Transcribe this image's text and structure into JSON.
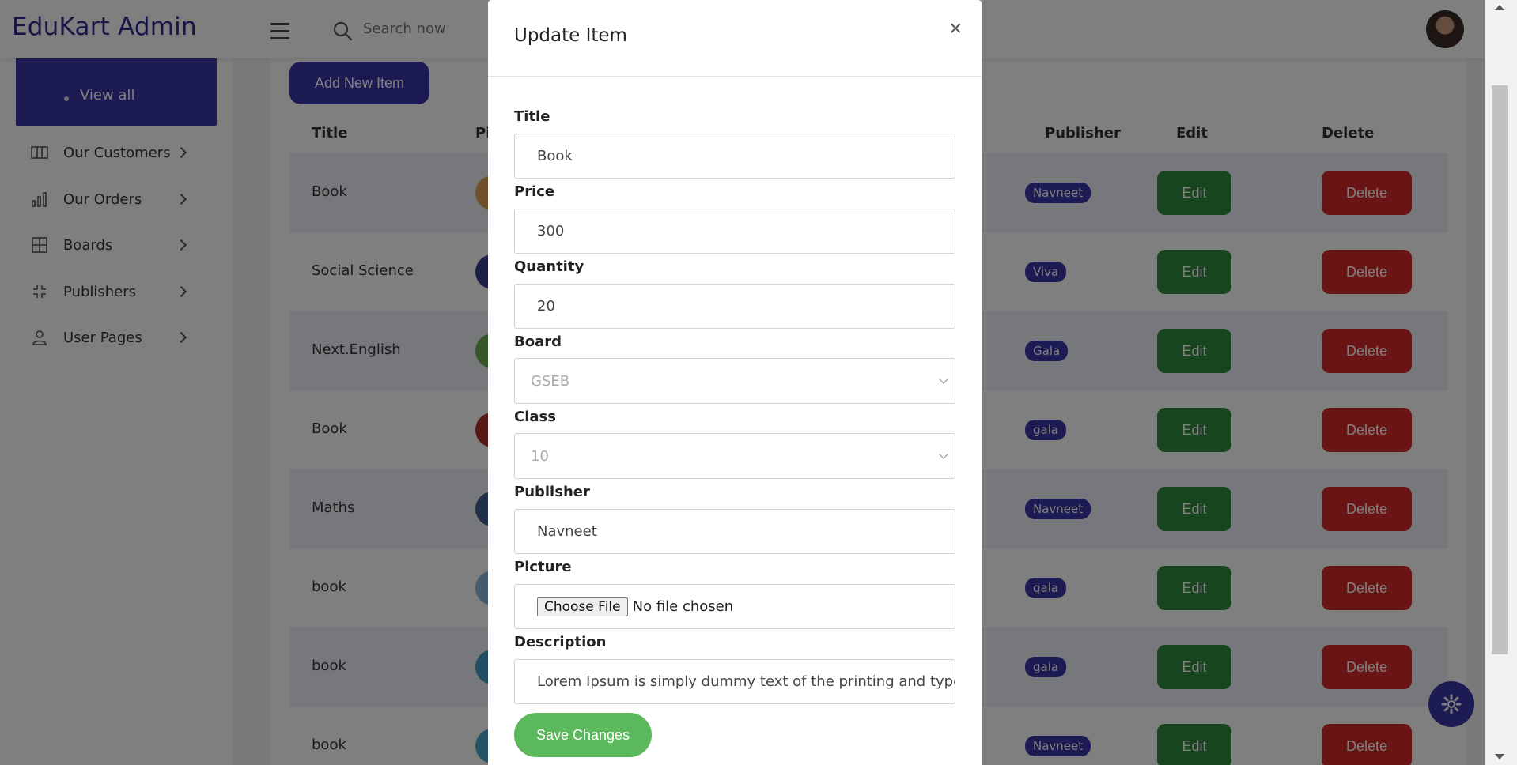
{
  "header": {
    "brand": "EduKart Admin",
    "search_placeholder": "Search now"
  },
  "sidebar": {
    "sub_item": "View all",
    "items": [
      {
        "label": "Our Customers",
        "icon": "columns-icon"
      },
      {
        "label": "Our Orders",
        "icon": "bar-chart-icon"
      },
      {
        "label": "Boards",
        "icon": "grid-icon"
      },
      {
        "label": "Publishers",
        "icon": "collapse-icon"
      },
      {
        "label": "User Pages",
        "icon": "user-icon"
      }
    ]
  },
  "main": {
    "add_button": "Add New Item",
    "columns": [
      "Title",
      "Pi",
      "Publisher",
      "Edit",
      "Delete"
    ],
    "edit_label": "Edit",
    "delete_label": "Delete",
    "rows": [
      {
        "title": "Book",
        "publisher": "Navneet",
        "pic_color": "#e0a050"
      },
      {
        "title": "Social Science",
        "publisher": "Viva",
        "pic_color": "#3a3f8a"
      },
      {
        "title": "Next.English",
        "publisher": "Gala",
        "pic_color": "#6aa84f"
      },
      {
        "title": "Book",
        "publisher": "gala",
        "pic_color": "#b03030"
      },
      {
        "title": "Maths",
        "publisher": "Navneet",
        "pic_color": "#3d5f8f"
      },
      {
        "title": "book",
        "publisher": "gala",
        "pic_color": "#8ab4d8"
      },
      {
        "title": "book",
        "publisher": "gala",
        "pic_color": "#3d9bc9"
      },
      {
        "title": "book",
        "publisher": "Navneet",
        "pic_color": "#4fa8c8"
      }
    ]
  },
  "modal": {
    "title": "Update Item",
    "fields": {
      "title": {
        "label": "Title",
        "value": "Book"
      },
      "price": {
        "label": "Price",
        "value": "300"
      },
      "quantity": {
        "label": "Quantity",
        "value": "20"
      },
      "board": {
        "label": "Board",
        "value": "GSEB"
      },
      "class": {
        "label": "Class",
        "value": "10"
      },
      "publisher": {
        "label": "Publisher",
        "value": "Navneet"
      },
      "picture": {
        "label": "Picture",
        "button": "Choose File",
        "status": "No file chosen"
      },
      "description": {
        "label": "Description",
        "value": "Lorem Ipsum is simply dummy text of the printing and typesettir"
      }
    },
    "save_button": "Save Changes"
  },
  "colors": {
    "brand": "#3b37a8",
    "edit": "#2e8b3a",
    "delete": "#d42b2b",
    "save": "#5cb85c"
  }
}
